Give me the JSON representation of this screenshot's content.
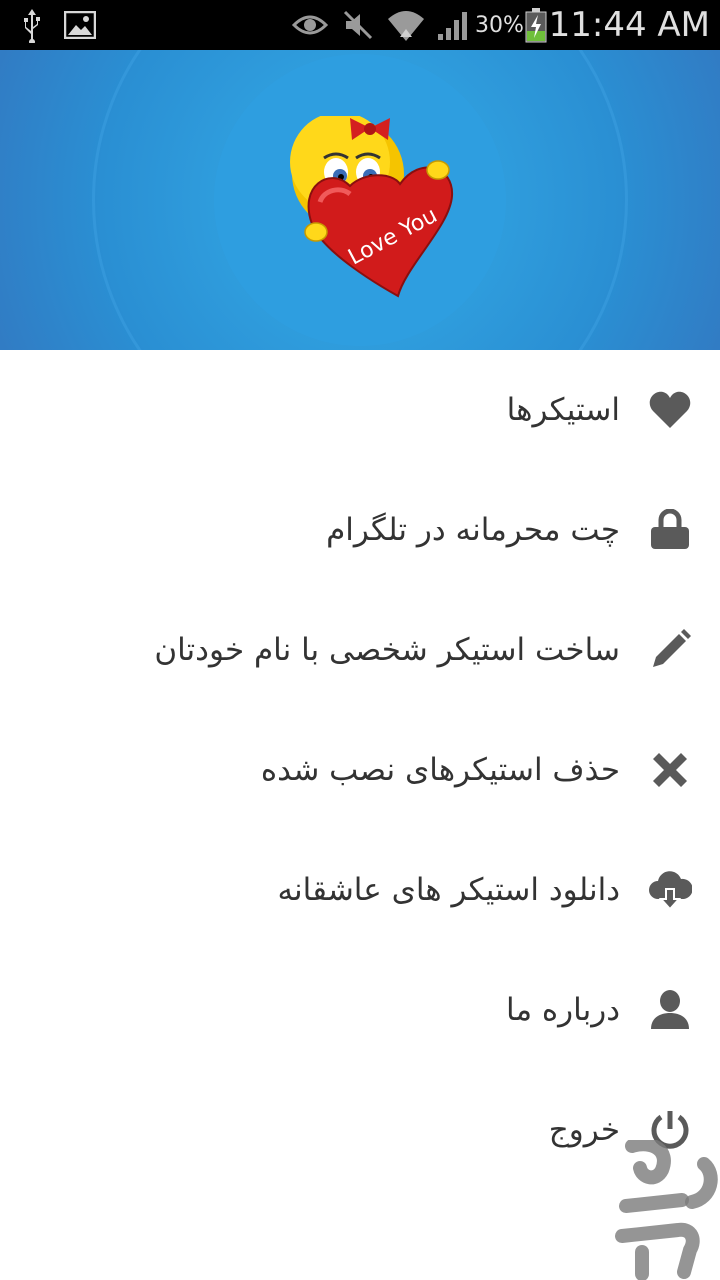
{
  "status_bar": {
    "time": "11:44 AM",
    "battery_percent": "30%",
    "icons": [
      "usb-icon",
      "image-icon",
      "eye-icon",
      "mute-icon",
      "wifi-icon",
      "signal-icon",
      "battery-charging-icon"
    ]
  },
  "header": {
    "image_caption": "Love You"
  },
  "menu": {
    "items": [
      {
        "label": "استیکرها",
        "icon": "heart-icon"
      },
      {
        "label": "چت محرمانه در تلگرام",
        "icon": "lock-icon"
      },
      {
        "label": "ساخت استیکر شخصی با نام خودتان",
        "icon": "pencil-icon"
      },
      {
        "label": "حذف استیکرهای نصب شده",
        "icon": "close-icon"
      },
      {
        "label": "دانلود استیکر های عاشقانه",
        "icon": "cloud-download-icon"
      },
      {
        "label": "درباره ما",
        "icon": "user-icon"
      },
      {
        "label": "خروج",
        "icon": "power-icon"
      }
    ]
  },
  "colors": {
    "header_blue": "#2f9ddd",
    "icon_gray": "#5a5a5a",
    "text": "#333333"
  }
}
